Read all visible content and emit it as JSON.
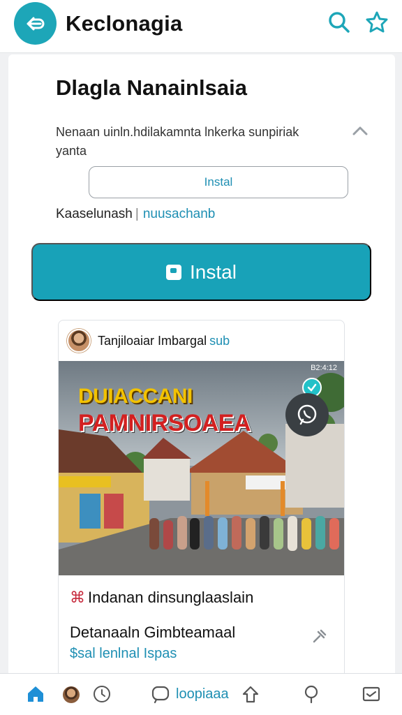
{
  "app": {
    "title": "Keclonagia"
  },
  "card": {
    "heading": "Dlagla Nanainlsaia",
    "description": "Nenaan uinln.hdilakamnta lnkerka sunpiriak yanta",
    "outline_button_label": "Instal",
    "meta_label": "Kaaselunash",
    "meta_separator": "|",
    "meta_link": "nuusachanb",
    "primary_button_label": "Instal"
  },
  "post": {
    "author": "Tanjiloaiar Imbargal",
    "author_sub": "sub",
    "image": {
      "time": "B2:4:12",
      "headline_line1": "DUIACCANI",
      "headline_line2": "PAMNIRSOAEA"
    },
    "caption_icon": "⌘",
    "caption": "Indanan dinsunglaaslain",
    "title": "Detanaaln Gimbteamaal",
    "price": "$sal lenlnal Ispas"
  },
  "bottom_nav": {
    "label": "loopiaaa"
  },
  "icons": {
    "back": "back-arrow-icon",
    "search": "search-icon",
    "star": "star-icon",
    "chevron": "chevron-up-icon",
    "pin": "pin-icon",
    "whatsapp": "whatsapp-icon",
    "verified": "check-icon",
    "home": "home-icon",
    "heart": "heart-icon",
    "chat": "chat-icon",
    "share": "upload-icon",
    "location": "location-icon",
    "message": "message-icon"
  },
  "colors": {
    "accent": "#18a2b8",
    "link": "#1e8fb3",
    "headline_yellow": "#f2c200",
    "headline_red": "#d32020"
  }
}
